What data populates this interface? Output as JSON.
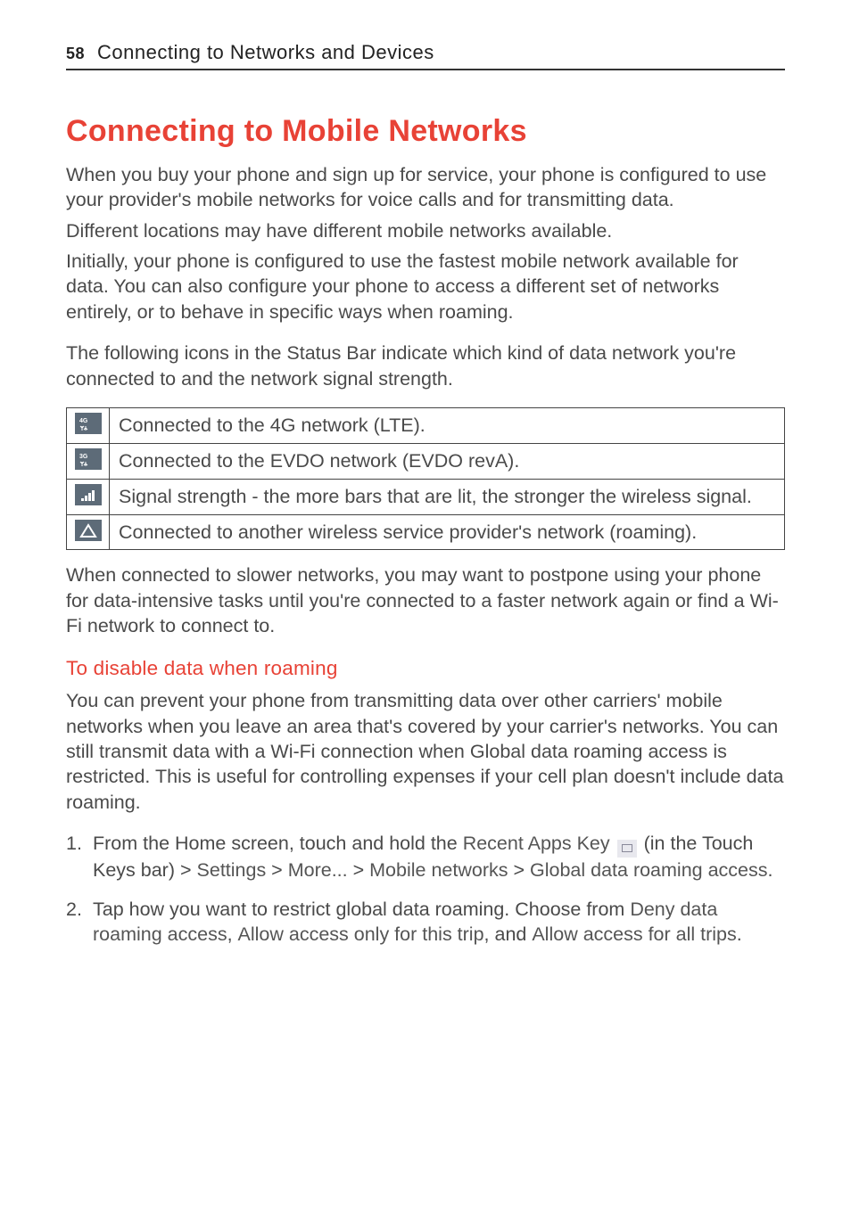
{
  "header": {
    "page_number": "58",
    "section": "Connecting to Networks and Devices"
  },
  "h1": "Connecting to Mobile Networks",
  "p1": "When you buy your phone and sign up for service, your phone is configured to use your provider's mobile networks for voice calls and for transmitting data.",
  "p1b": "Different locations may have different mobile networks available.",
  "p1c": "Initially, your phone is configured to use the fastest mobile network available for data. You can also configure your phone to access a different set of networks entirely, or to behave in specific ways when roaming.",
  "p2": "The following icons in the Status Bar indicate which kind of data network you're connected to and the network signal strength.",
  "icon_table": [
    {
      "icon": "4g-lte-icon",
      "desc": "Connected to the 4G network (LTE)."
    },
    {
      "icon": "3g-icon",
      "desc": "Connected to the EVDO network (EVDO revA)."
    },
    {
      "icon": "signal-bars-icon",
      "desc": "Signal strength - the more bars that are lit, the stronger the wireless signal."
    },
    {
      "icon": "roaming-triangle-icon",
      "desc": "Connected to another wireless service provider's network (roaming)."
    }
  ],
  "p3": "When connected to slower networks, you may want to postpone using your phone for data-intensive tasks until you're connected to a faster network again or find a Wi-Fi network to connect to.",
  "h2": "To disable data when roaming",
  "p4": "You can prevent your phone from transmitting data over other carriers' mobile networks when you leave an area that's covered by your carrier's networks. You can still transmit data with a Wi-Fi connection when Global data roaming access is restricted. This is useful for controlling expenses if your cell plan doesn't include data roaming.",
  "step1": {
    "pre": " From the Home screen, touch and hold the ",
    "bold_a": "Recent Apps Key",
    "mid1": " (in the Touch Keys bar) > ",
    "bold_b": "Settings",
    "sep": " > ",
    "bold_c": "More...",
    "bold_d": "Mobile networks",
    "bold_e": "Global data roaming access",
    "end": "."
  },
  "step2": {
    "pre": " Tap how you want to restrict global data roaming. Choose from ",
    "bold_a": "Deny data roaming access",
    "sep1": ", ",
    "bold_b": "Allow access only for this trip",
    "sep2": ", and ",
    "bold_c": "Allow access for all trips",
    "end": "."
  },
  "icons": {
    "4g_label": "4G",
    "3g_label": "3G"
  }
}
